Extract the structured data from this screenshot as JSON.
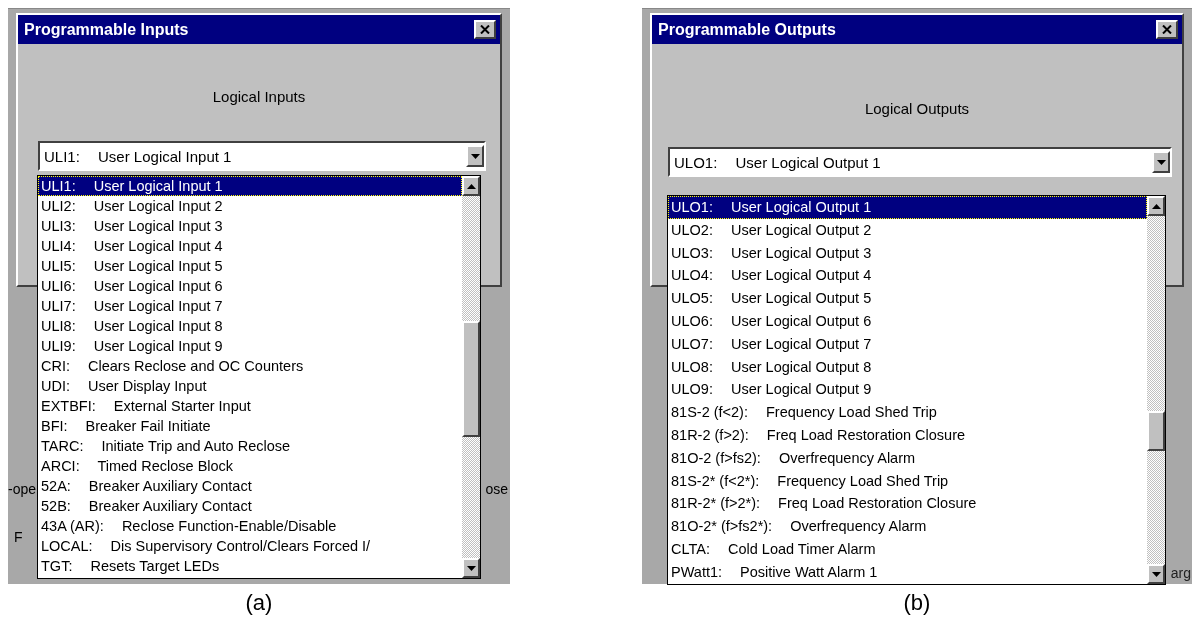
{
  "panels": [
    {
      "caption": "(a)",
      "dialog": {
        "title": "Programmable Inputs",
        "label": "Logical Inputs",
        "combo_value": {
          "code": "ULI1:",
          "text": "User Logical Input 1"
        }
      },
      "background_fragments": {
        "left": "-ope",
        "right": "ose",
        "lower_left": "F"
      },
      "items": [
        {
          "code": "ULI1:",
          "text": "User Logical Input 1",
          "selected": true
        },
        {
          "code": "ULI2:",
          "text": "User Logical Input 2",
          "selected": false
        },
        {
          "code": "ULI3:",
          "text": "User Logical Input 3",
          "selected": false
        },
        {
          "code": "ULI4:",
          "text": "User Logical Input 4",
          "selected": false
        },
        {
          "code": "ULI5:",
          "text": "User Logical Input 5",
          "selected": false
        },
        {
          "code": "ULI6:",
          "text": "User Logical Input 6",
          "selected": false
        },
        {
          "code": "ULI7:",
          "text": "User Logical Input 7",
          "selected": false
        },
        {
          "code": "ULI8:",
          "text": "User Logical Input 8",
          "selected": false
        },
        {
          "code": "ULI9:",
          "text": "User Logical Input 9",
          "selected": false
        },
        {
          "code": "CRI:",
          "text": "Clears Reclose and OC Counters",
          "selected": false
        },
        {
          "code": "UDI:",
          "text": "User Display Input",
          "selected": false
        },
        {
          "code": "EXTBFI:",
          "text": "External Starter Input",
          "selected": false
        },
        {
          "code": "BFI:",
          "text": "Breaker Fail Initiate",
          "selected": false
        },
        {
          "code": "TARC:",
          "text": "Initiate Trip and Auto Reclose",
          "selected": false
        },
        {
          "code": "ARCI:",
          "text": "Timed Reclose Block",
          "selected": false
        },
        {
          "code": "52A:",
          "text": "Breaker Auxiliary Contact",
          "selected": false
        },
        {
          "code": "52B:",
          "text": "Breaker Auxiliary Contact",
          "selected": false
        },
        {
          "code": "43A (AR):",
          "text": "Reclose Function-Enable/Disable",
          "selected": false
        },
        {
          "code": "LOCAL:",
          "text": "Dis Supervisory Control/Clears Forced I/",
          "selected": false
        },
        {
          "code": "TGT:",
          "text": "Resets Target LEDs",
          "selected": false
        }
      ]
    },
    {
      "caption": "(b)",
      "dialog": {
        "title": "Programmable Outputs",
        "label": "Logical Outputs",
        "combo_value": {
          "code": "ULO1:",
          "text": "User Logical Output 1"
        }
      },
      "background_fragments": {
        "right": "arg"
      },
      "items": [
        {
          "code": "ULO1:",
          "text": "User Logical Output 1",
          "selected": true
        },
        {
          "code": "ULO2:",
          "text": "User Logical Output 2",
          "selected": false
        },
        {
          "code": "ULO3:",
          "text": "User Logical Output 3",
          "selected": false
        },
        {
          "code": "ULO4:",
          "text": "User Logical Output 4",
          "selected": false
        },
        {
          "code": "ULO5:",
          "text": "User Logical Output 5",
          "selected": false
        },
        {
          "code": "ULO6:",
          "text": "User Logical Output 6",
          "selected": false
        },
        {
          "code": "ULO7:",
          "text": "User Logical Output 7",
          "selected": false
        },
        {
          "code": "ULO8:",
          "text": "User Logical Output 8",
          "selected": false
        },
        {
          "code": "ULO9:",
          "text": "User Logical Output 9",
          "selected": false
        },
        {
          "code": "81S-2 (f<2):",
          "text": "Frequency Load Shed Trip",
          "selected": false
        },
        {
          "code": "81R-2 (f>2):",
          "text": "Freq Load Restoration Closure",
          "selected": false
        },
        {
          "code": "81O-2 (f>fs2):",
          "text": "Overfrequency Alarm",
          "selected": false
        },
        {
          "code": "81S-2* (f<2*):",
          "text": "Frequency Load Shed Trip",
          "selected": false
        },
        {
          "code": "81R-2* (f>2*):",
          "text": "Freq Load Restoration Closure",
          "selected": false
        },
        {
          "code": "81O-2* (f>fs2*):",
          "text": "Overfrequency Alarm",
          "selected": false
        },
        {
          "code": "CLTA:",
          "text": "Cold Load Timer Alarm",
          "selected": false
        },
        {
          "code": "PWatt1:",
          "text": "Positive Watt Alarm 1",
          "selected": false
        }
      ]
    }
  ]
}
